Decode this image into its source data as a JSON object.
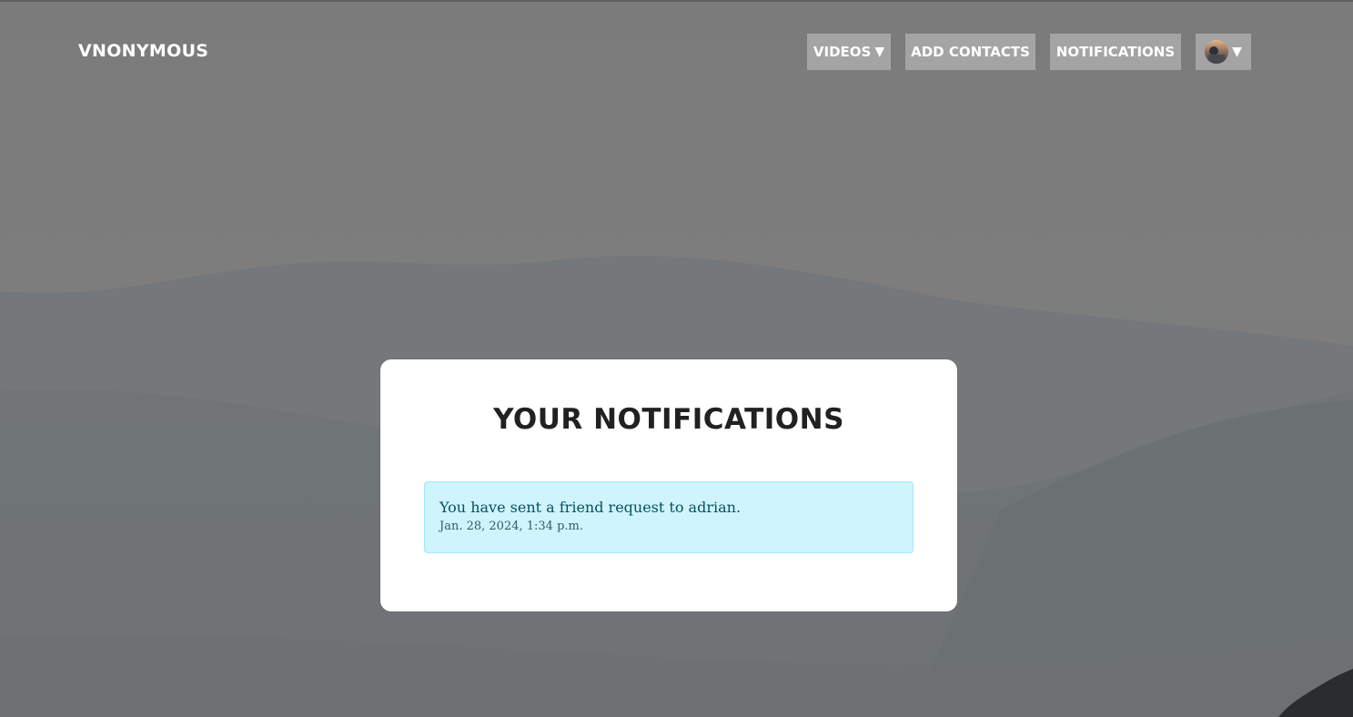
{
  "brand": "VNONYMOUS",
  "nav": {
    "videos_label": "VIDEOS",
    "videos_caret": "▼",
    "add_contacts_label": "ADD CONTACTS",
    "notifications_label": "NOTIFICATIONS",
    "profile_caret": "▼"
  },
  "page": {
    "title": "YOUR NOTIFICATIONS"
  },
  "notifications": [
    {
      "message": "You have sent a friend request to adrian.",
      "timestamp": "Jan. 28, 2024, 1:34 p.m."
    }
  ],
  "colors": {
    "nav_button_bg": "#a4a4a4",
    "alert_bg": "#cff4fc",
    "alert_border": "#9eeaf9",
    "alert_text": "#055160"
  },
  "icons": {
    "videos_dropdown": "caret-down-icon",
    "profile_dropdown": "caret-down-icon",
    "avatar": "user-avatar"
  }
}
